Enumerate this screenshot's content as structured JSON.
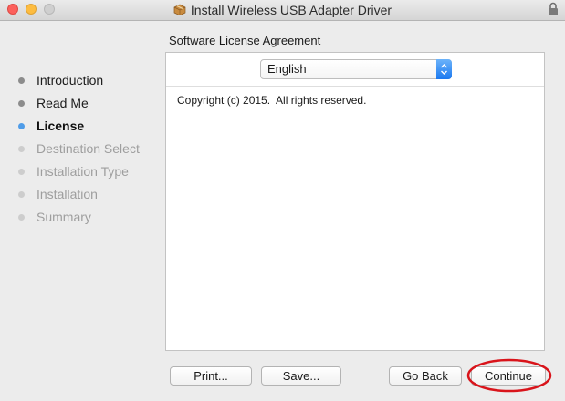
{
  "window": {
    "title": "Install Wireless USB Adapter Driver",
    "icon": "package-icon",
    "lock_icon": "lock-icon"
  },
  "heading": "Software License Agreement",
  "sidebar": {
    "steps": [
      {
        "label": "Introduction",
        "state": "completed"
      },
      {
        "label": "Read Me",
        "state": "completed"
      },
      {
        "label": "License",
        "state": "current"
      },
      {
        "label": "Destination Select",
        "state": "pending"
      },
      {
        "label": "Installation Type",
        "state": "pending"
      },
      {
        "label": "Installation",
        "state": "pending"
      },
      {
        "label": "Summary",
        "state": "pending"
      }
    ]
  },
  "language_select": {
    "selected": "English"
  },
  "license_text": "Copyright (c) 2015.  All rights reserved.",
  "buttons": {
    "print": "Print...",
    "save": "Save...",
    "go_back": "Go Back",
    "continue": "Continue"
  },
  "colors": {
    "current_step_dot": "#4f9ce8",
    "completed_step_dot": "#8c8c8c",
    "pending_step_dot": "#cdcdcd",
    "highlight_ring": "#d9141b"
  }
}
